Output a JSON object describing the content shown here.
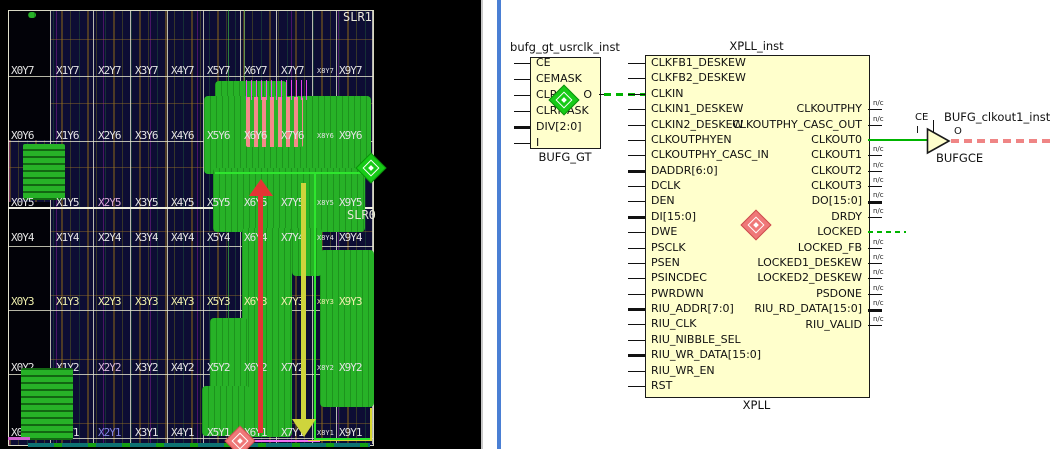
{
  "device_view": {
    "slr1_label": "SLR1",
    "slr0_label": "SLR0",
    "region_rows": [
      {
        "name": "Y7",
        "cells": [
          "X0Y7",
          "X1Y7",
          "X2Y7",
          "X3Y7",
          "X4Y7",
          "X5Y7",
          "X6Y7",
          "X7Y7",
          "X8Y7",
          "X9Y7"
        ]
      },
      {
        "name": "Y6",
        "cells": [
          "X0Y6",
          "X1Y6",
          "X2Y6",
          "X3Y6",
          "X4Y6",
          "X5Y6",
          "X6Y6",
          "X7Y6",
          "X8Y6",
          "X9Y6"
        ]
      },
      {
        "name": "Y5",
        "cells": [
          "X0Y5",
          "X1Y5",
          "X2Y5",
          "X3Y5",
          "X4Y5",
          "X5Y5",
          "X6Y5",
          "X7Y5",
          "X8Y5",
          "X9Y5"
        ]
      },
      {
        "name": "Y4",
        "cells": [
          "X0Y4",
          "X1Y4",
          "X2Y4",
          "X3Y4",
          "X4Y4",
          "X5Y4",
          "X6Y4",
          "X7Y4",
          "X8Y4",
          "X9Y4"
        ]
      },
      {
        "name": "Y3",
        "cells": [
          "X0Y3",
          "X1Y3",
          "X2Y3",
          "X3Y3",
          "X4Y3",
          "X5Y3",
          "X6Y3",
          "X7Y3",
          "X8Y3",
          "X9Y3"
        ]
      },
      {
        "name": "Y2",
        "cells": [
          "X0Y2",
          "X1Y2",
          "X2Y2",
          "X3Y2",
          "X4Y2",
          "X5Y2",
          "X6Y2",
          "X7Y2",
          "X8Y2",
          "X9Y2"
        ]
      },
      {
        "name": "Y1",
        "cells": [
          "X0Y1",
          "X1Y1",
          "X2Y1",
          "X3Y1",
          "X4Y1",
          "X5Y1",
          "X6Y1",
          "X7Y1",
          "X8Y1",
          "X9Y1"
        ]
      }
    ]
  },
  "schematic": {
    "bufg_gt": {
      "instance": "bufg_gt_usrclk_inst",
      "cell_type": "BUFG_GT",
      "input_pins": [
        "CE",
        "CEMASK",
        "CLR",
        "CLRMASK",
        "DIV[2:0]",
        "I"
      ],
      "output_pin": "O"
    },
    "xpll": {
      "instance": "XPLL_inst",
      "cell_type": "XPLL",
      "input_pins": [
        "CLKFB1_DESKEW",
        "CLKFB2_DESKEW",
        "CLKIN",
        "CLKIN1_DESKEW",
        "CLKIN2_DESKEW",
        "CLKOUTPHYEN",
        "CLKOUTPHY_CASC_IN",
        "DADDR[6:0]",
        "DCLK",
        "DEN",
        "DI[15:0]",
        "DWE",
        "PSCLK",
        "PSEN",
        "PSINCDEC",
        "PWRDWN",
        "RIU_ADDR[7:0]",
        "RIU_CLK",
        "RIU_NIBBLE_SEL",
        "RIU_WR_DATA[15:0]",
        "RIU_WR_EN",
        "RST"
      ],
      "output_pins": [
        "CLKOUTPHY",
        "CLKOUTPHY_CASC_OUT",
        "CLKOUT0",
        "CLKOUT1",
        "CLKOUT2",
        "CLKOUT3",
        "DO[15:0]",
        "DRDY",
        "LOCKED",
        "LOCKED_FB",
        "LOCKED1_DESKEW",
        "LOCKED2_DESKEW",
        "PSDONE",
        "RIU_RD_DATA[15:0]",
        "RIU_VALID"
      ]
    },
    "bufgce": {
      "instance": "BUFG_clkout1_inst",
      "cell_type": "BUFGCE",
      "pin_ce": "CE",
      "pin_i": "I",
      "pin_o": "O"
    },
    "nc_text": "n/c"
  },
  "colors": {
    "divider_blue": "#4a7fd4",
    "wire_green": "#00b400",
    "highlight_red_dash": "#ef8585",
    "block_fill": "#ffffcc",
    "marker_green": "#17cb17",
    "marker_red": "#ef7878",
    "placement_green": "#27b227",
    "congestion_pink": "#f48a8a",
    "arrow_red": "#e43434",
    "arrow_yellow": "#ced43c",
    "device_background": "#0d0d34"
  }
}
